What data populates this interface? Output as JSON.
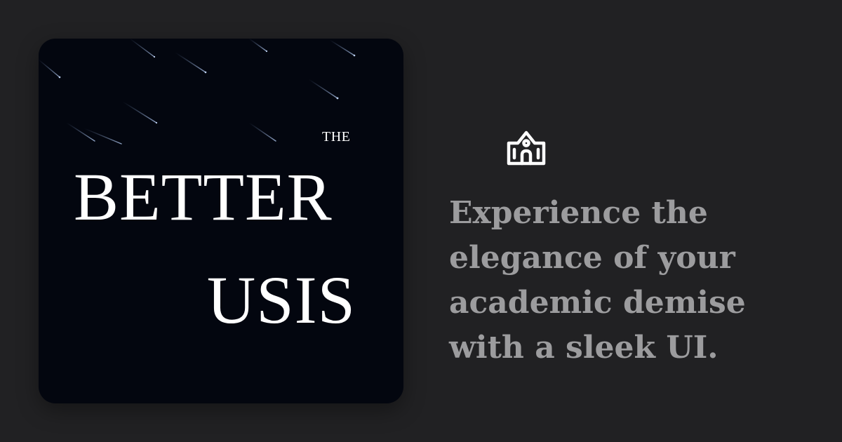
{
  "banner": {
    "logo": {
      "small_word": "THE",
      "line1": "BETTER",
      "line2": "USIS"
    },
    "icon": "school-building-icon",
    "tagline": "Experience the elegance of your academic demise with a sleek UI."
  },
  "colors": {
    "background": "#212123",
    "card": "#03060f",
    "logo_text": "#ffffff",
    "tagline_text": "#9c9c9e",
    "icon": "#ffffff"
  }
}
